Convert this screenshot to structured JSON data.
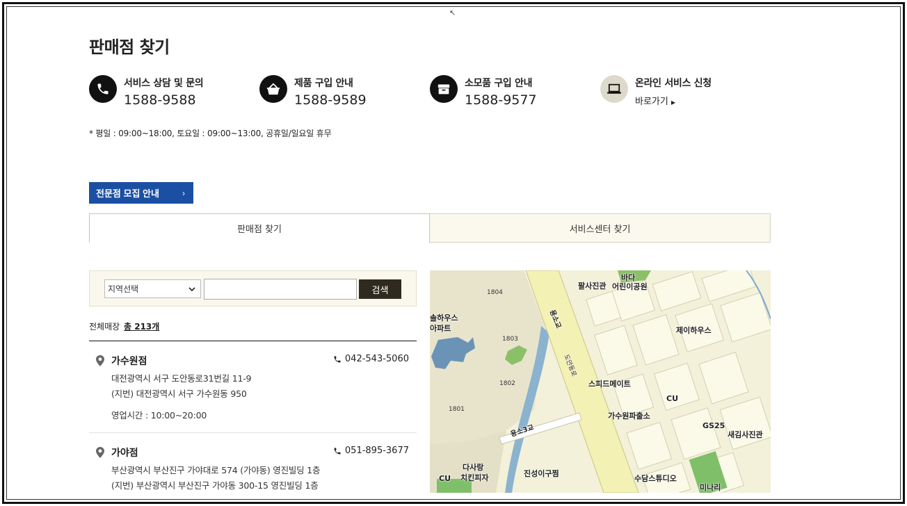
{
  "page": {
    "title": "판매점 찾기"
  },
  "contacts": [
    {
      "label": "서비스 상담 및 문의",
      "phone": "1588-9588",
      "icon": "phone-icon"
    },
    {
      "label": "제품 구입 안내",
      "phone": "1588-9589",
      "icon": "basket-icon"
    },
    {
      "label": "소모품 구입 안내",
      "phone": "1588-9577",
      "icon": "box-icon"
    },
    {
      "label": "온라인 서비스 신청",
      "link": "바로가기",
      "icon": "laptop-icon"
    }
  ],
  "hours_note": "* 평일 : 09:00~18:00, 토요일 : 09:00~13:00, 공휴일/일요일 휴무",
  "recruit_button": {
    "label": "전문점 모집 안내",
    "chevron": "›"
  },
  "tabs": [
    {
      "label": "판매점 찾기",
      "active": true
    },
    {
      "label": "서비스센터 찾기",
      "active": false
    }
  ],
  "search": {
    "region_selected": "지역선택",
    "keyword_value": "",
    "button_label": "검색"
  },
  "total": {
    "prefix": "전체매장",
    "count": "총 213개"
  },
  "stores": [
    {
      "name": "가수원점",
      "phone": "042-543-5060",
      "address": "대전광역시 서구 도안동로31번길 11-9",
      "lot_address": "(지번) 대전광역시 서구 가수원동 950",
      "hours": "영업시간 : 10:00~20:00"
    },
    {
      "name": "가야점",
      "phone": "051-895-3677",
      "address": "부산광역시 부산진구 가야대로 574 (가야동) 영진빌딩 1층",
      "lot_address": "(지번) 부산광역시 부산진구 가야동 300-15 영진빌딩 1층"
    }
  ],
  "map": {
    "labels": {
      "palsa": "팔사진관",
      "bada": "바다",
      "bada_park": "어린이공원",
      "hahouse_1": "솔하우스",
      "hahouse_2": "아파트",
      "jay": "제이하우스",
      "speed": "스피드메이트",
      "cu1": "CU",
      "police": "가수원파출소",
      "gs25": "GS25",
      "saekim": "새김사진관",
      "dasarang_1": "다사랑",
      "dasarang_2": "치킨피자",
      "cu2": "CU",
      "jinseong": "진성이구찜",
      "sudam": "수담스튜디오",
      "minari": "미나리",
      "yongso_bridge": "용소교",
      "doan_road": "도안동로",
      "yongso3": "용소3교"
    },
    "buildings": [
      "1804",
      "1803",
      "1802",
      "1801"
    ]
  },
  "colors": {
    "recruit_blue": "#1a4fa3",
    "search_btn": "#2f2a1f",
    "icon_light": "#dedacb"
  }
}
